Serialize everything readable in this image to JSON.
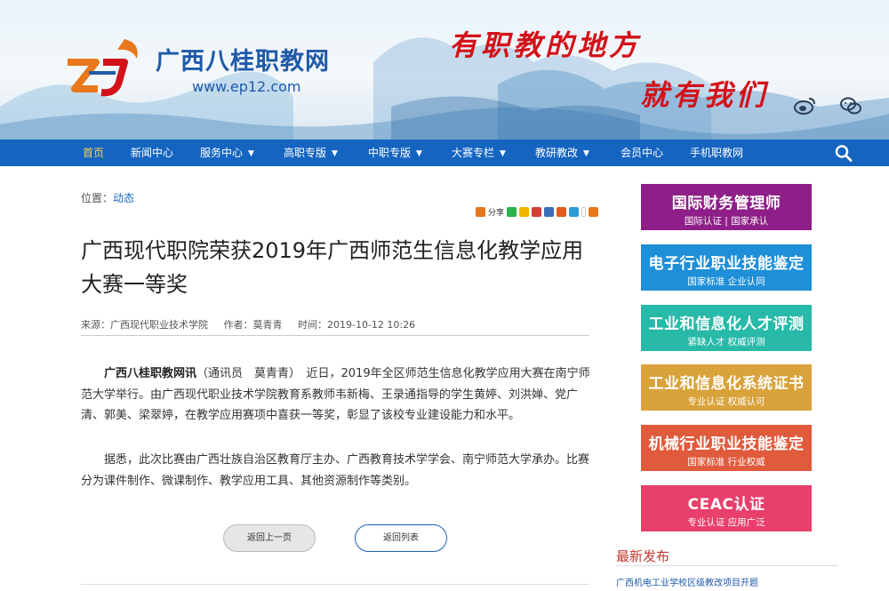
{
  "header": {
    "site_name": "广西八桂职教网",
    "site_url": "www.ep12.com",
    "slogan_line1": "有职教的地方",
    "slogan_line2": "就有我们",
    "logo_letters": "ZJ"
  },
  "nav": {
    "items": [
      {
        "label": "首页",
        "active": true,
        "dropdown": false
      },
      {
        "label": "新闻中心",
        "dropdown": false
      },
      {
        "label": "服务中心",
        "dropdown": true
      },
      {
        "label": "高职专版",
        "dropdown": true
      },
      {
        "label": "中职专版",
        "dropdown": true
      },
      {
        "label": "大赛专栏",
        "dropdown": true
      },
      {
        "label": "教研教改",
        "dropdown": true
      },
      {
        "label": "会员中心",
        "dropdown": false
      },
      {
        "label": "手机职教网",
        "dropdown": false
      }
    ],
    "search_icon": "search-icon"
  },
  "breadcrumb": {
    "prefix": "位置：",
    "link": "动态"
  },
  "share": {
    "label": "分享"
  },
  "article": {
    "title": "广西现代职院荣获2019年广西师范生信息化教学应用大赛一等奖",
    "meta": {
      "source": "来源：广西现代职业技术学院",
      "author": "作者：莫青青",
      "time": "时间：2019-10-12 10:26"
    },
    "para1_lead": "广西八桂职教网讯",
    "para1_body": "（通讯员　莫青青）　近日，2019年全区师范生信息化教学应用大赛在南宁师范大学举行。由广西现代职业技术学院教育系教师韦新梅、王录通指导的学生黄婷、刘洪婵、党广清、郭美、梁翠婷，在教学应用赛项中喜获一等奖，彰显了该校专业建设能力和水平。",
    "para2": "据悉，此次比赛由广西壮族自治区教育厅主办、广西教育技术学学会、南宁师范大学承办。比赛分为课件制作、微课制作、教学应用工具、其他资源制作等类别。",
    "prev_button": "返回上一页",
    "list_button": "返回列表"
  },
  "sidebar": {
    "ads": [
      {
        "title": "国际财务管理师",
        "subtitle": "国际认证 | 国家承认",
        "color": "#8e1f88"
      },
      {
        "title": "电子行业职业技能鉴定",
        "subtitle": "国家标准  企业认同",
        "color": "#1e8fd8"
      },
      {
        "title": "工业和信息化人才评测",
        "subtitle": "紧缺人才  权威评测",
        "color": "#28b9a9"
      },
      {
        "title": "工业和信息化系统证书",
        "subtitle": "专业认证  权威认可",
        "color": "#d9a23a"
      },
      {
        "title": "机械行业职业技能鉴定",
        "subtitle": "国家标准  行业权威",
        "color": "#e05a3c"
      },
      {
        "title": "CEAC认证",
        "subtitle": "专业认证  应用广泛",
        "color": "#e93f6b"
      }
    ],
    "latest_title": "最新发布",
    "latest_items": [
      "广西机电工业学校区级教改项目开题"
    ]
  }
}
